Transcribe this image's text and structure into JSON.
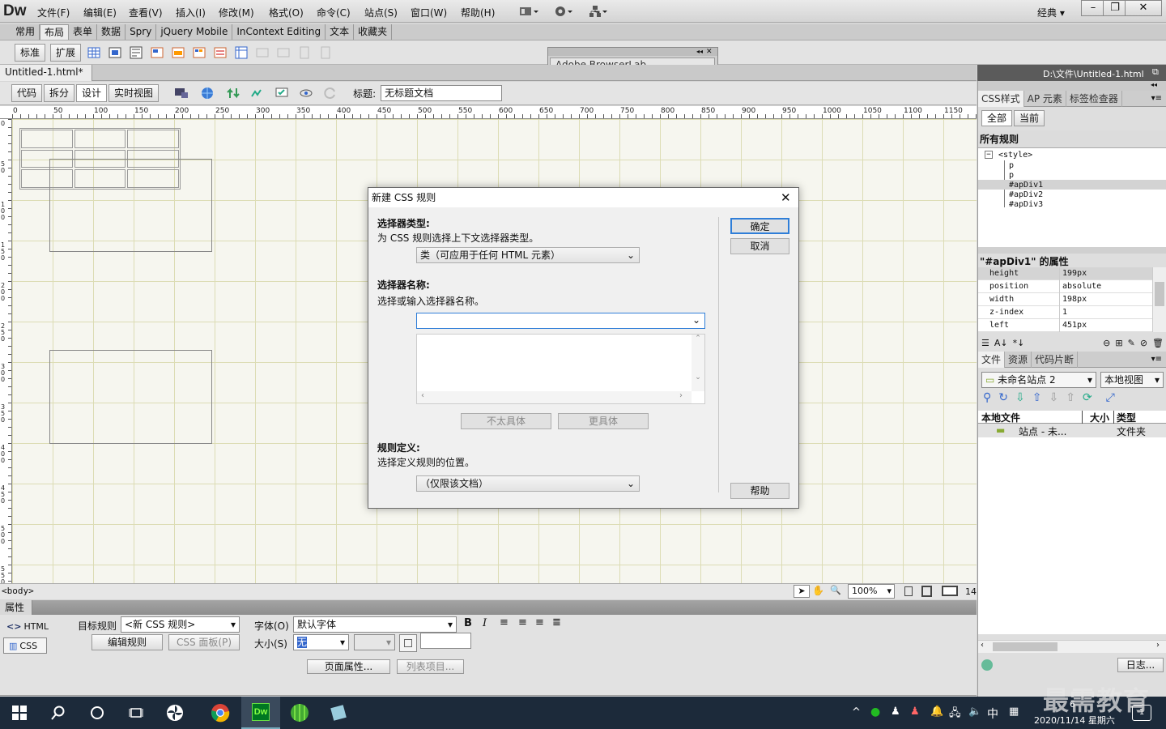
{
  "app": {
    "logo": "Dw",
    "layout_mode": "经典",
    "doc_path": "D:\\文件\\Untitled-1.html"
  },
  "menu": [
    "文件(F)",
    "编辑(E)",
    "查看(V)",
    "插入(I)",
    "修改(M)",
    "格式(O)",
    "命令(C)",
    "站点(S)",
    "窗口(W)",
    "帮助(H)"
  ],
  "insert_tabs": [
    "常用",
    "布局",
    "表单",
    "数据",
    "Spry",
    "jQuery Mobile",
    "InContext Editing",
    "文本",
    "收藏夹"
  ],
  "insert_tools": {
    "standard": "标准",
    "expanded": "扩展"
  },
  "browserlab": {
    "title": "Adobe BrowserLab"
  },
  "document": {
    "tab": "Untitled-1.html*",
    "views": [
      "代码",
      "拆分",
      "设计",
      "实时视图"
    ],
    "title_label": "标题:",
    "title_value": "无标题文档"
  },
  "ruler": {
    "marks": [
      "0",
      "50",
      "100",
      "150",
      "200",
      "250",
      "300",
      "350",
      "400",
      "450",
      "500",
      "550",
      "600",
      "650",
      "700",
      "750",
      "800",
      "850",
      "900",
      "950",
      "1000",
      "1050",
      "1100",
      "1150"
    ],
    "vmarks": [
      "0",
      "50",
      "100",
      "150",
      "200",
      "250",
      "300",
      "350",
      "400",
      "450",
      "500",
      "550",
      "600"
    ]
  },
  "statusbar": {
    "tag": "<body>",
    "zoom": "100%",
    "width_trunc": "14"
  },
  "properties": {
    "header": "属性",
    "html_btn": "HTML",
    "css_btn": "CSS",
    "target_rule_label": "目标规则",
    "target_rule": "<新 CSS 规则>",
    "edit_rule": "编辑规则",
    "css_panel": "CSS 面板(P)",
    "font_label": "字体(O)",
    "font_value": "默认字体",
    "size_label": "大小(S)",
    "size_value": "无",
    "page_props": "页面属性...",
    "list_item": "列表项目..."
  },
  "css_panel": {
    "tabs": [
      "CSS样式",
      "AP 元素",
      "标签检查器"
    ],
    "modes": [
      "全部",
      "当前"
    ],
    "all_rules": "所有规则",
    "rules_tree": [
      "<style>",
      "p",
      "p",
      "#apDiv1",
      "#apDiv2",
      "#apDiv3"
    ],
    "props_title": "\"#apDiv1\" 的属性",
    "props": [
      {
        "k": "height",
        "v": "199px"
      },
      {
        "k": "position",
        "v": "absolute"
      },
      {
        "k": "width",
        "v": "198px"
      },
      {
        "k": "z-index",
        "v": "1"
      },
      {
        "k": "left",
        "v": "451px"
      }
    ]
  },
  "files_panel": {
    "tabs": [
      "文件",
      "资源",
      "代码片断"
    ],
    "site": "未命名站点 2",
    "view": "本地视图",
    "cols": [
      "本地文件",
      "大小",
      "类型"
    ],
    "row_name": "站点 - 未...",
    "row_type": "文件夹",
    "log_btn": "日志..."
  },
  "dialog": {
    "title": "新建 CSS 规则",
    "sel_type_label": "选择器类型:",
    "sel_type_desc": "为 CSS 规则选择上下文选择器类型。",
    "sel_type_value": "类（可应用于任何 HTML 元素）",
    "sel_name_label": "选择器名称:",
    "sel_name_desc": "选择或输入选择器名称。",
    "sel_name_value": "",
    "less_specific": "不太具体",
    "more_specific": "更具体",
    "rule_def_label": "规则定义:",
    "rule_def_desc": "选择定义规则的位置。",
    "rule_def_value": "（仅限该文档）",
    "ok": "确定",
    "cancel": "取消",
    "help": "帮助"
  },
  "taskbar": {
    "time": "6",
    "date": "2020/11/14 星期六",
    "ime": "中",
    "notif_count": "1",
    "watermark": "最需教育"
  }
}
